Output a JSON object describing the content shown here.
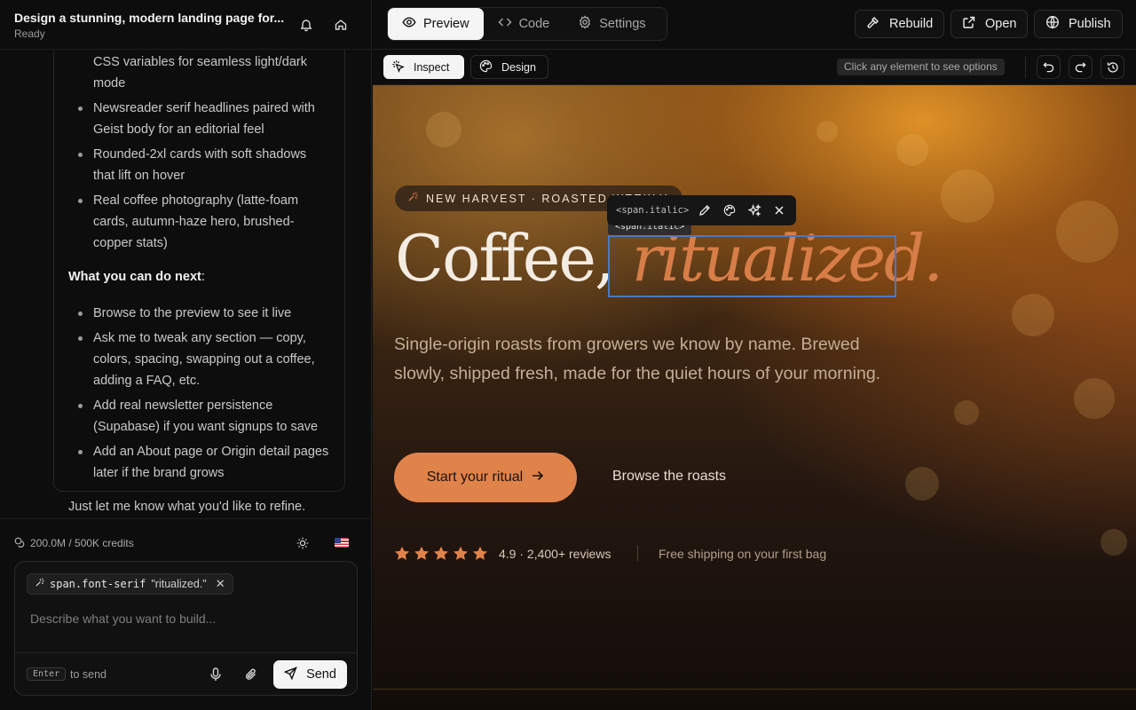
{
  "project": {
    "title": "Design a stunning, modern landing page for...",
    "status": "Ready"
  },
  "chat": {
    "bullets_top": [
      "CSS variables for seamless light/dark mode",
      "Newsreader serif headlines paired with Geist body for an editorial feel",
      "Rounded-2xl cards with soft shadows that lift on hover",
      "Real coffee photography (latte-foam cards, autumn-haze hero, brushed-copper stats)"
    ],
    "next_heading": "What you can do next",
    "next_colon": ":",
    "bullets_next": [
      "Browse to the preview to see it live",
      "Ask me to tweak any section — copy, colors, spacing, swapping out a coffee, adding a FAQ, etc.",
      "Add real newsletter persistence (Supabase) if you want signups to save",
      "Add an About page or Origin detail pages later if the brand grows"
    ],
    "closing": "Just let me know what you'd like to refine."
  },
  "credits": {
    "text": "200.0M / 500K credits"
  },
  "composer": {
    "chip_selector": "span.font-serif",
    "chip_text": "\"ritualized.\"",
    "placeholder": "Describe what you want to build...",
    "kbd": "Enter",
    "send_hint": "to send",
    "send_label": "Send"
  },
  "tabs": [
    {
      "label": "Preview",
      "icon": "eye-icon",
      "active": true
    },
    {
      "label": "Code",
      "icon": "code-icon",
      "active": false
    },
    {
      "label": "Settings",
      "icon": "gear-icon",
      "active": false
    }
  ],
  "actions": {
    "rebuild": "Rebuild",
    "open": "Open",
    "publish": "Publish"
  },
  "preview_toolbar": {
    "inspect": "Inspect",
    "design": "Design",
    "hint": "Click any element to see options"
  },
  "hero": {
    "badge": "NEW HARVEST · ROASTED WEEKLY",
    "headline_plain": "Coffee, ",
    "headline_italic": "ritualized.",
    "subhead": "Single-origin roasts from growers we know by name. Brewed slowly, shipped fresh, made for the quiet hours of your morning.",
    "cta_primary": "Start your ritual",
    "cta_secondary": "Browse the roasts",
    "rating": "4.9 · 2,400+ reviews",
    "stars": 5,
    "shipping": "Free shipping on your first bag"
  },
  "inspector": {
    "element_tag": "<span.italic>",
    "selection_label": "<span.italic>"
  },
  "colors": {
    "accent": "#e0834b",
    "selection": "#4a78c8",
    "headline": "#f4ece2"
  }
}
